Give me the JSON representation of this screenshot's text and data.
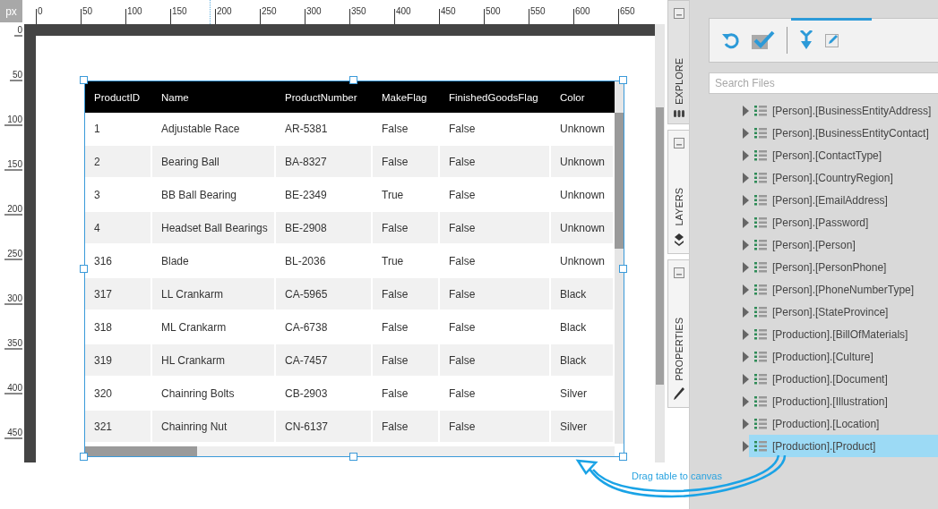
{
  "ruler": {
    "unit": "px",
    "top_labels": [
      "0",
      "50",
      "100",
      "150",
      "200",
      "250",
      "300",
      "350",
      "400",
      "450",
      "500",
      "550",
      "600",
      "650"
    ],
    "left_labels": [
      "0",
      "50",
      "100",
      "150",
      "200",
      "250",
      "300",
      "350",
      "400",
      "450"
    ]
  },
  "table": {
    "selected": true,
    "columns": [
      "ProductID",
      "Name",
      "ProductNumber",
      "MakeFlag",
      "FinishedGoodsFlag",
      "Color"
    ],
    "rows": [
      [
        "1",
        "Adjustable Race",
        "AR-5381",
        "False",
        "False",
        "Unknown"
      ],
      [
        "2",
        "Bearing Ball",
        "BA-8327",
        "False",
        "False",
        "Unknown"
      ],
      [
        "3",
        "BB Ball Bearing",
        "BE-2349",
        "True",
        "False",
        "Unknown"
      ],
      [
        "4",
        "Headset Ball Bearings",
        "BE-2908",
        "False",
        "False",
        "Unknown"
      ],
      [
        "316",
        "Blade",
        "BL-2036",
        "True",
        "False",
        "Unknown"
      ],
      [
        "317",
        "LL Crankarm",
        "CA-5965",
        "False",
        "False",
        "Black"
      ],
      [
        "318",
        "ML Crankarm",
        "CA-6738",
        "False",
        "False",
        "Black"
      ],
      [
        "319",
        "HL Crankarm",
        "CA-7457",
        "False",
        "False",
        "Black"
      ],
      [
        "320",
        "Chainring Bolts",
        "CB-2903",
        "False",
        "False",
        "Silver"
      ],
      [
        "321",
        "Chainring Nut",
        "CN-6137",
        "False",
        "False",
        "Silver"
      ]
    ]
  },
  "side_tabs": [
    {
      "label": "EXPLORE",
      "selected": true,
      "kind": "explore"
    },
    {
      "label": "LAYERS",
      "selected": false,
      "kind": "layers"
    },
    {
      "label": "PROPERTIES",
      "selected": false,
      "kind": "properties"
    }
  ],
  "search": {
    "placeholder": "Search Files"
  },
  "tree": [
    {
      "label": "[Person].[BusinessEntityAddress]",
      "selected": false
    },
    {
      "label": "[Person].[BusinessEntityContact]",
      "selected": false
    },
    {
      "label": "[Person].[ContactType]",
      "selected": false
    },
    {
      "label": "[Person].[CountryRegion]",
      "selected": false
    },
    {
      "label": "[Person].[EmailAddress]",
      "selected": false
    },
    {
      "label": "[Person].[Password]",
      "selected": false
    },
    {
      "label": "[Person].[Person]",
      "selected": false
    },
    {
      "label": "[Person].[PersonPhone]",
      "selected": false
    },
    {
      "label": "[Person].[PhoneNumberType]",
      "selected": false
    },
    {
      "label": "[Person].[StateProvince]",
      "selected": false
    },
    {
      "label": "[Production].[BillOfMaterials]",
      "selected": false
    },
    {
      "label": "[Production].[Culture]",
      "selected": false
    },
    {
      "label": "[Production].[Document]",
      "selected": false
    },
    {
      "label": "[Production].[Illustration]",
      "selected": false
    },
    {
      "label": "[Production].[Location]",
      "selected": false
    },
    {
      "label": "[Production].[Product]",
      "selected": true
    }
  ],
  "hint": {
    "text": "Drag table to canvas"
  }
}
